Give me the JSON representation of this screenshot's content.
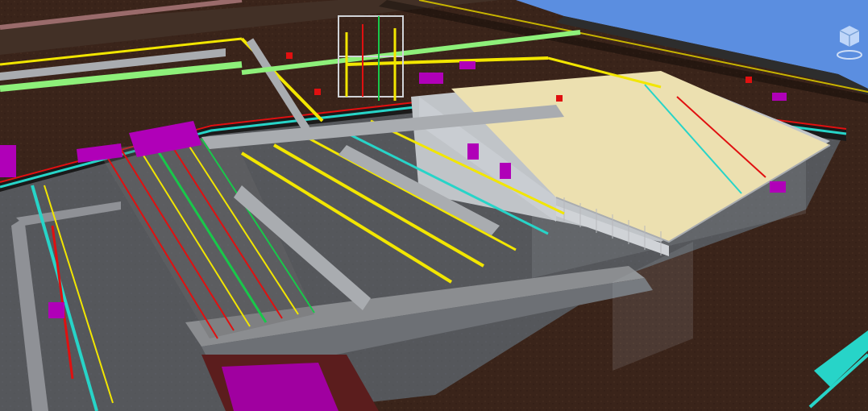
{
  "viewer": {
    "background_sky": "#5b8ee0",
    "ground_color": "#3b2419",
    "slab_color": "#56585d",
    "wall_color": "#8b8d90",
    "pipe_yellow": "#f2e600",
    "pipe_red": "#e01010",
    "pipe_green": "#18c84a",
    "pipe_light_green": "#8ef07a",
    "pipe_cyan": "#27d4c8",
    "equipment_magenta": "#b000b8",
    "tank_roof": "#ece0b0",
    "tank_wall": "#c9cdd2",
    "steel_gray": "#a9acb0"
  },
  "widgets": {
    "view_cube": "view-cube-icon"
  }
}
